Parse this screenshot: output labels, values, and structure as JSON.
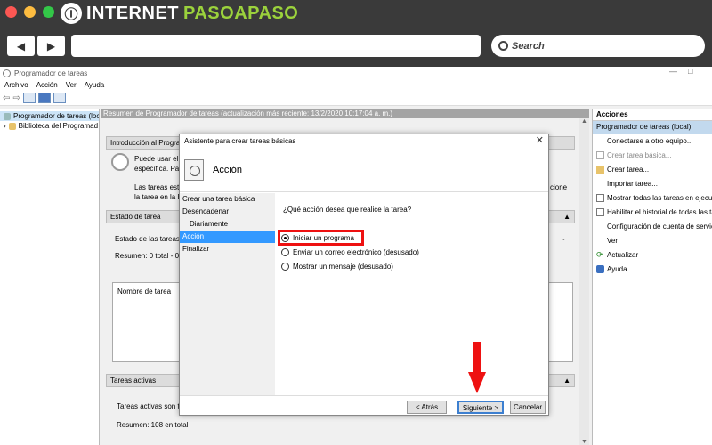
{
  "browser": {
    "brand_part1": "INTERNET",
    "brand_part2": "PASOAPASO",
    "brand_logo": "Ⓘ",
    "back": "◀",
    "forward": "▶",
    "search_placeholder": "Search"
  },
  "window": {
    "title": "Programador de tareas",
    "controls": {
      "minimize": "—",
      "maximize": "□"
    },
    "menu": [
      "Archivo",
      "Acción",
      "Ver",
      "Ayuda"
    ]
  },
  "tree": {
    "items": [
      "Programador de tareas (local)",
      "Biblioteca del Programad"
    ]
  },
  "center": {
    "summary": "Resumen de Programador de tareas (actualización más reciente: 13/2/2020 10:17:04 a. m.)",
    "intro_header": "Introducción al Programa",
    "intro_text1": "Puede usar el P",
    "intro_text2": "específica. Para",
    "intro_text3": "Las tareas están",
    "intro_text4": "la tarea en la Bib",
    "intro_right": "cione",
    "status_header": "Estado de tarea",
    "status_label": "Estado de las tareas qu",
    "status_summary": "Resumen: 0 total - 0 en",
    "name_col": "Nombre de tarea",
    "active_header": "Tareas activas",
    "active_text": "Tareas activas son ta",
    "active_summary": "Resumen: 108 en total"
  },
  "actions": {
    "header": "Acciones",
    "sub": "Programador de tareas (local)",
    "items": [
      "Conectarse a otro equipo...",
      "Crear tarea básica...",
      "Crear tarea...",
      "Importar tarea...",
      "Mostrar todas las tareas en ejecución",
      "Habilitar el historial de todas las tar...",
      "Configuración de cuenta de servici...",
      "Ver",
      "Actualizar",
      "Ayuda"
    ]
  },
  "dialog": {
    "title": "Asistente para crear tareas básicas",
    "close": "✕",
    "heading": "Acción",
    "steps": [
      "Crear una tarea básica",
      "Desencadenar",
      "Diariamente",
      "Acción",
      "Finalizar"
    ],
    "question": "¿Qué acción desea que realice la tarea?",
    "options": [
      "Iniciar un programa",
      "Enviar un correo electrónico (desusado)",
      "Mostrar un mensaje (desusado)"
    ],
    "selected_option": "Iniciar un programa",
    "buttons": {
      "back": "< Atrás",
      "next": "Siguiente >",
      "cancel": "Cancelar"
    }
  },
  "colors": {
    "highlight": "#e11111",
    "selection": "#3399ff"
  }
}
